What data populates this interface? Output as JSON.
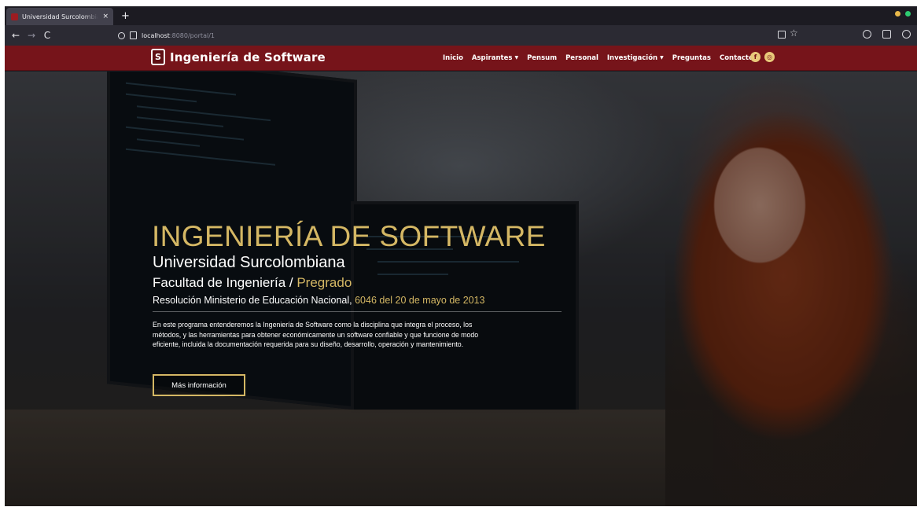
{
  "browser": {
    "tab_title": "Universidad Surcolombiana",
    "tab_close": "×",
    "new_tab": "+",
    "back": "←",
    "forward": "→",
    "reload": "C",
    "url_host": "localhost",
    "url_path": ":8080/portal/1",
    "window_dot_colors": [
      "#e8b84a",
      "#2ecc71"
    ]
  },
  "site": {
    "brand_logo_letter": "S",
    "brand_name": "Ingeniería de Software",
    "nav_color": "#76141a",
    "accent_color": "#d4b764",
    "menu": [
      {
        "label": "Inicio",
        "dropdown": false
      },
      {
        "label": "Aspirantes",
        "dropdown": true
      },
      {
        "label": "Pensum",
        "dropdown": false
      },
      {
        "label": "Personal",
        "dropdown": false
      },
      {
        "label": "Investigación",
        "dropdown": true
      },
      {
        "label": "Preguntas",
        "dropdown": false
      },
      {
        "label": "Contacto",
        "dropdown": false
      }
    ],
    "social_icons": [
      "facebook-icon",
      "instagram-icon"
    ]
  },
  "hero": {
    "title": "INGENIERÍA DE SOFTWARE",
    "university": "Universidad Surcolombiana",
    "faculty": "Facultad de Ingeniería / ",
    "faculty_level": "Pregrado",
    "resolution": "Resolución Ministerio de Educación Nacional, ",
    "resolution_ref": "6046 del 20 de mayo de 2013",
    "description": "En este programa entenderemos la Ingeniería de Software como la disciplina que integra el proceso, los métodos, y las herramientas para obtener económicamente un software confiable y que funcione de modo eficiente, incluida la documentación requerida para su diseño, desarrollo, operación y mantenimiento.",
    "cta_label": "Más información"
  }
}
